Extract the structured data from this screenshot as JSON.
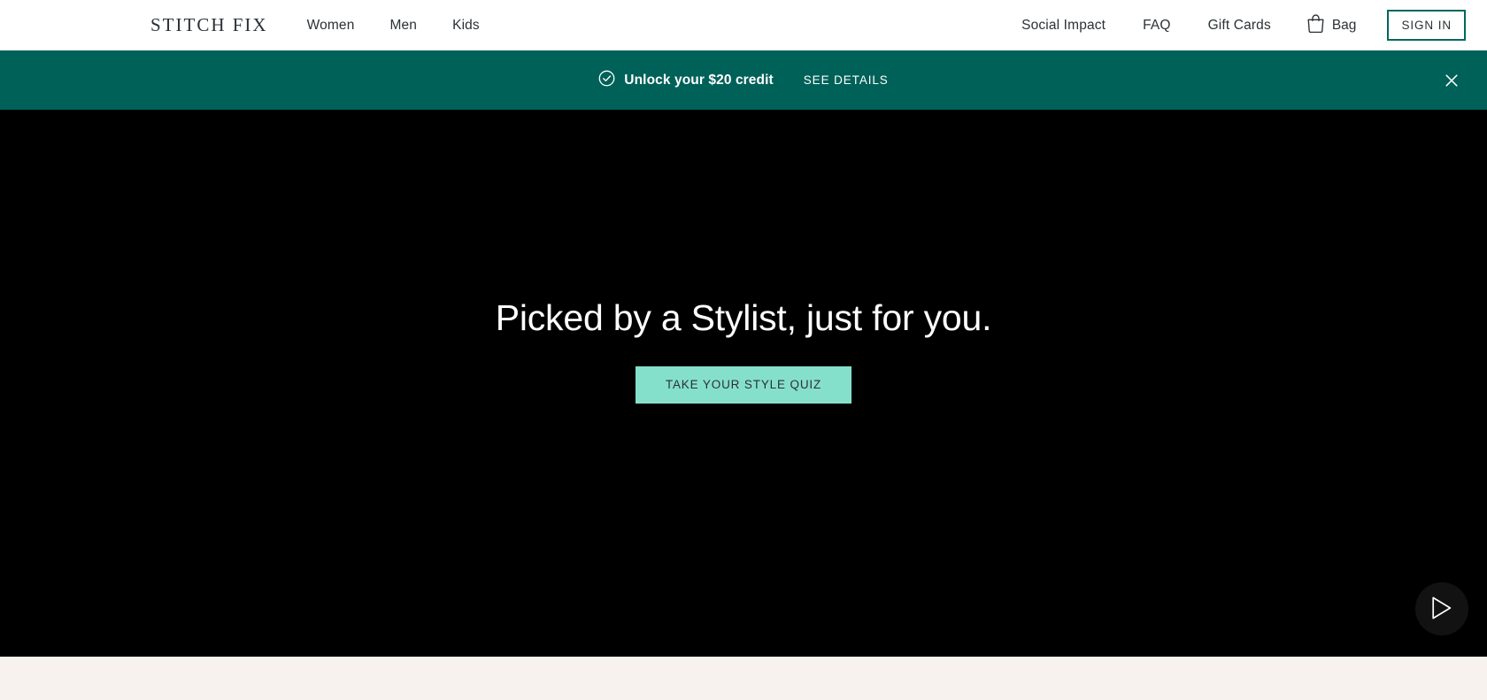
{
  "header": {
    "brand": "STITCH FIX",
    "nav_left": [
      {
        "label": "Women",
        "name": "nav-women"
      },
      {
        "label": "Men",
        "name": "nav-men"
      },
      {
        "label": "Kids",
        "name": "nav-kids"
      }
    ],
    "nav_right": [
      {
        "label": "Social Impact",
        "name": "nav-social-impact"
      },
      {
        "label": "FAQ",
        "name": "nav-faq"
      },
      {
        "label": "Gift Cards",
        "name": "nav-gift-cards"
      }
    ],
    "bag_label": "Bag",
    "bag_icon": "shopping-bag-icon",
    "sign_in_label": "SIGN IN"
  },
  "promo": {
    "icon": "check-circle-icon",
    "message": "Unlock your $20 credit",
    "details_label": "SEE DETAILS",
    "close_icon": "close-icon",
    "background_color": "#006158"
  },
  "hero": {
    "title": "Picked by a Stylist, just for you.",
    "cta_label": "TAKE YOUR STYLE QUIZ",
    "cta_color": "#85e0cb",
    "background_color": "#000000",
    "play_icon": "play-icon"
  },
  "below_fold": {
    "background_color": "#f7f2ee"
  }
}
